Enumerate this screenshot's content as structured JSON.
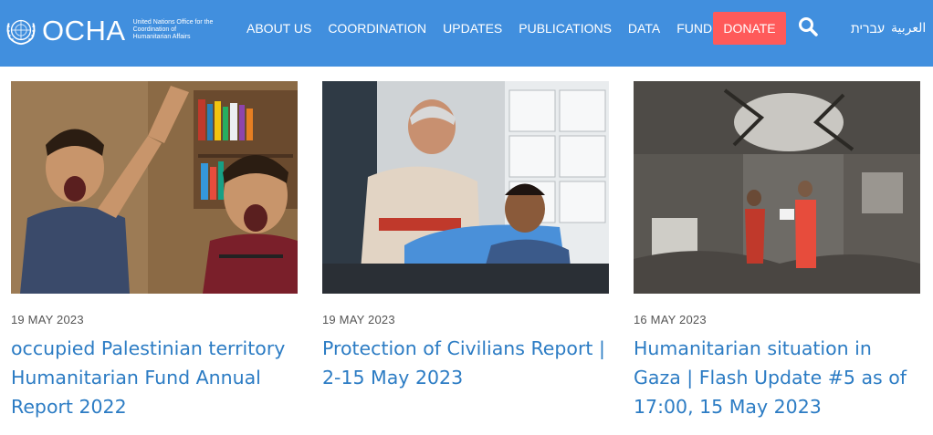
{
  "header": {
    "logo_word": "OCHA",
    "logo_subtitle": "United Nations Office for the Coordination of Humanitarian Affairs",
    "logo_icon": "un-emblem-icon",
    "colors": {
      "background": "#418fde",
      "donate": "#ff5a5a",
      "text": "#ffffff"
    }
  },
  "nav": {
    "items": [
      {
        "label": "ABOUT US"
      },
      {
        "label": "COORDINATION"
      },
      {
        "label": "UPDATES"
      },
      {
        "label": "PUBLICATIONS"
      },
      {
        "label": "DATA"
      },
      {
        "label": "FUNDING"
      }
    ],
    "donate_label": "DONATE",
    "search_icon": "search-icon",
    "languages": {
      "hebrew": "עברית",
      "arabic": "العربية"
    }
  },
  "cards": [
    {
      "date": "19 MAY 2023",
      "title": "occupied Palestinian territory Humanitarian Fund Annual Report 2022"
    },
    {
      "date": "19 MAY 2023",
      "title": "Protection of Civilians Report | 2-15 May 2023"
    },
    {
      "date": "16 MAY 2023",
      "title": "Humanitarian situation in Gaza | Flash Update #5 as of 17:00, 15 May 2023"
    }
  ],
  "colors": {
    "link": "#2c7cc4",
    "date": "#555555"
  }
}
